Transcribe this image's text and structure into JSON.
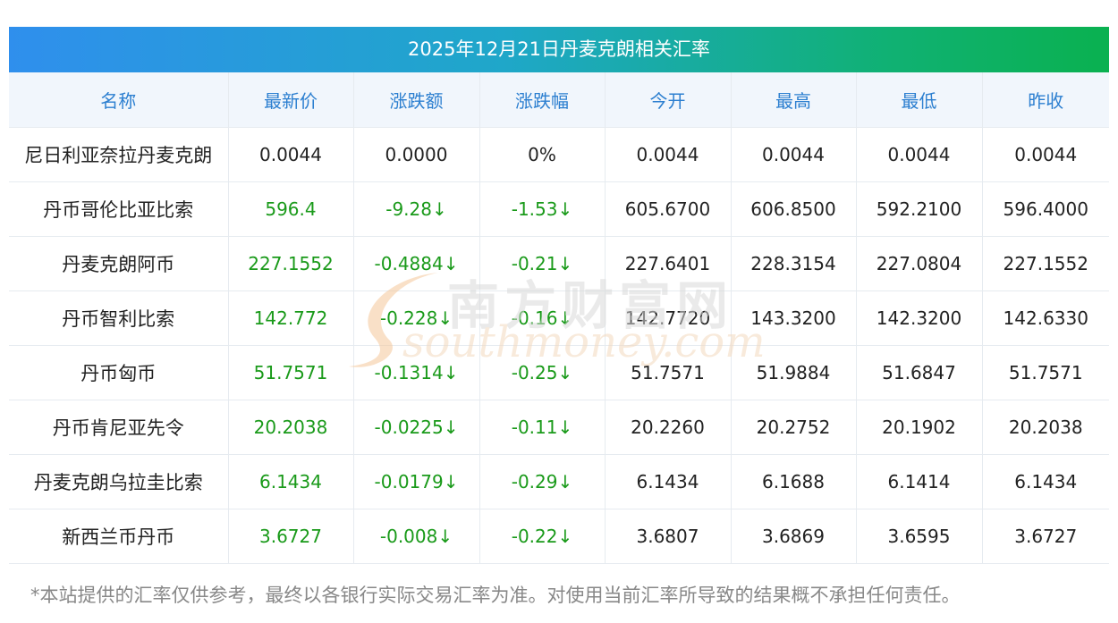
{
  "title": "2025年12月21日丹麦克朗相关汇率",
  "columns": [
    "名称",
    "最新价",
    "涨跌额",
    "涨跌幅",
    "今开",
    "最高",
    "最低",
    "昨收"
  ],
  "rows": [
    {
      "name": "尼日利亚奈拉丹麦克朗",
      "latest": "0.0044",
      "change": "0.0000",
      "pct": "0%",
      "open": "0.0044",
      "high": "0.0044",
      "low": "0.0044",
      "prev": "0.0044",
      "down": false
    },
    {
      "name": "丹币哥伦比亚比索",
      "latest": "596.4",
      "change": "-9.28↓",
      "pct": "-1.53↓",
      "open": "605.6700",
      "high": "606.8500",
      "low": "592.2100",
      "prev": "596.4000",
      "down": true
    },
    {
      "name": "丹麦克朗阿币",
      "latest": "227.1552",
      "change": "-0.4884↓",
      "pct": "-0.21↓",
      "open": "227.6401",
      "high": "228.3154",
      "low": "227.0804",
      "prev": "227.1552",
      "down": true
    },
    {
      "name": "丹币智利比索",
      "latest": "142.772",
      "change": "-0.228↓",
      "pct": "-0.16↓",
      "open": "142.7720",
      "high": "143.3200",
      "low": "142.3200",
      "prev": "142.6330",
      "down": true
    },
    {
      "name": "丹币匈币",
      "latest": "51.7571",
      "change": "-0.1314↓",
      "pct": "-0.25↓",
      "open": "51.7571",
      "high": "51.9884",
      "low": "51.6847",
      "prev": "51.7571",
      "down": true
    },
    {
      "name": "丹币肯尼亚先令",
      "latest": "20.2038",
      "change": "-0.0225↓",
      "pct": "-0.11↓",
      "open": "20.2260",
      "high": "20.2752",
      "low": "20.1902",
      "prev": "20.2038",
      "down": true
    },
    {
      "name": "丹麦克朗乌拉圭比索",
      "latest": "6.1434",
      "change": "-0.0179↓",
      "pct": "-0.29↓",
      "open": "6.1434",
      "high": "6.1688",
      "low": "6.1414",
      "prev": "6.1434",
      "down": true
    },
    {
      "name": "新西兰币丹币",
      "latest": "3.6727",
      "change": "-0.008↓",
      "pct": "-0.22↓",
      "open": "3.6807",
      "high": "3.6869",
      "low": "3.6595",
      "prev": "3.6727",
      "down": true
    }
  ],
  "footnote": "*本站提供的汇率仅供参考，最终以各银行实际交易汇率为准。对使用当前汇率所导致的结果概不承担任何责任。",
  "watermark": {
    "cn": "南方财富网",
    "en": "southmoney.com"
  },
  "colors": {
    "down": "#1a9a1a",
    "header_text": "#2c7fd0",
    "header_bg": "#f1f6fc"
  }
}
